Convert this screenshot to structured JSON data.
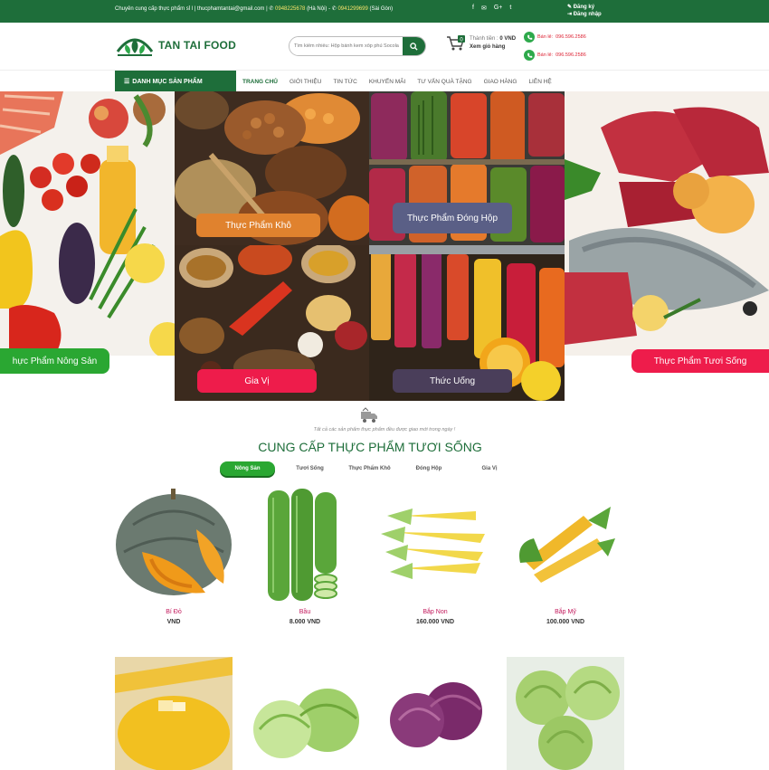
{
  "topbar": {
    "intro": "Chuyên cung cấp thực phẩm sỉ l | thucphamtantai@gmail.com |",
    "phone1": "0948225678",
    "city1": "(Hà Nội) -",
    "phone2": "0941299699",
    "city2": "(Sài Gòn)",
    "social": [
      "f",
      "✉",
      "G+",
      "t"
    ],
    "register": "Đăng ký",
    "login": "Đăng nhập"
  },
  "header": {
    "brand": "TAN TAI FOOD",
    "search_placeholder": "Tìm kiếm nhiều: Hộp bánh kem xốp phủ Socola",
    "cart_total_label": "Thành tiền :",
    "cart_total_value": "0 VND",
    "cart_view": "Xem giỏ hàng",
    "cart_count": "0",
    "hotline_label1": "Bán lẻ:",
    "hotline1": "096.596.2586",
    "hotline_label2": "Bán lẻ:",
    "hotline2": "096.596.2586"
  },
  "nav": {
    "category_button": "DANH MỤC SẢN PHẨM",
    "items": [
      "TRANG CHỦ",
      "GIỚI THIỆU",
      "TIN TỨC",
      "KHUYẾN MÃI",
      "TƯ VẤN QUÀ TẶNG",
      "GIAO HÀNG",
      "LIÊN HỆ"
    ]
  },
  "banners": {
    "nong_san": "hực Phẩm Nông Sản",
    "kho": "Thực Phẩm Khô",
    "dong_hop": "Thực Phẩm Đóng Hộp",
    "gia_vi": "Gia Vị",
    "thuc_uong": "Thức Uống",
    "tuoi_song": "Thực Phẩm Tươi Sống"
  },
  "section": {
    "intro": "Tất cả các sản phẩm thực phẩm đều được giao mới trong ngày !",
    "title": "CUNG CẤP THỰC PHẨM TƯƠI SỐNG",
    "tabs": [
      "Nông Sản",
      "Tươi Sống",
      "Thực Phẩm Khô",
      "Đóng Hộp",
      "Gia Vị"
    ]
  },
  "products": [
    {
      "name": "Bí Đỏ",
      "price": "VND"
    },
    {
      "name": "Bầu",
      "price": "8.000 VND"
    },
    {
      "name": "Bắp Non",
      "price": "160.000 VND"
    },
    {
      "name": "Bắp Mỹ",
      "price": "100.000 VND"
    }
  ],
  "colors": {
    "brand_green": "#1e6e3a",
    "tab_green": "#2aa732",
    "price_name": "#c2185b",
    "pill_red": "#ee1c4b",
    "pill_orange": "#e0822e",
    "pill_slate": "#5a5f86"
  }
}
